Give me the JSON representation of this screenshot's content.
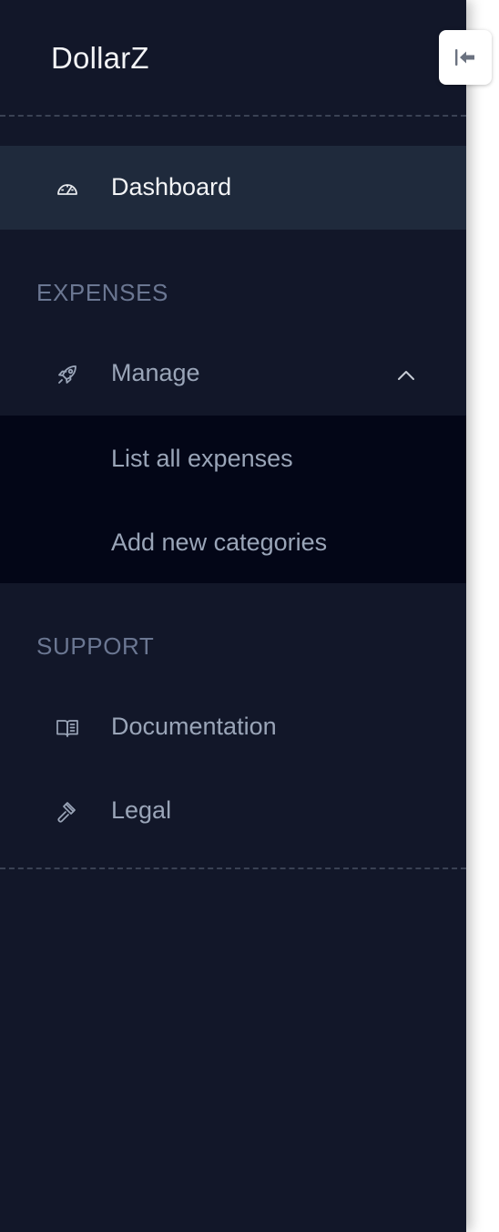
{
  "brand": {
    "name": "DollarZ"
  },
  "nav": {
    "dashboard": {
      "label": "Dashboard",
      "icon": "speedometer-icon"
    }
  },
  "sections": {
    "expenses": {
      "title": "EXPENSES",
      "manage": {
        "label": "Manage",
        "icon": "rocket-icon",
        "expanded": true,
        "chevron_icon": "chevron-up-icon",
        "children": [
          {
            "label": "List all expenses"
          },
          {
            "label": "Add new categories"
          }
        ]
      }
    },
    "support": {
      "title": "SUPPORT",
      "items": [
        {
          "label": "Documentation",
          "icon": "book-open-icon"
        },
        {
          "label": "Legal",
          "icon": "gavel-icon"
        }
      ]
    }
  },
  "toggle": {
    "icon": "collapse-sidebar-icon"
  },
  "colors": {
    "sidebar_bg": "#121729",
    "active_bg": "#1f2a3c",
    "submenu_bg": "#030617",
    "text_active": "#f3f4f6",
    "text_muted": "#9aa5b8",
    "section_title": "#6b7792"
  }
}
